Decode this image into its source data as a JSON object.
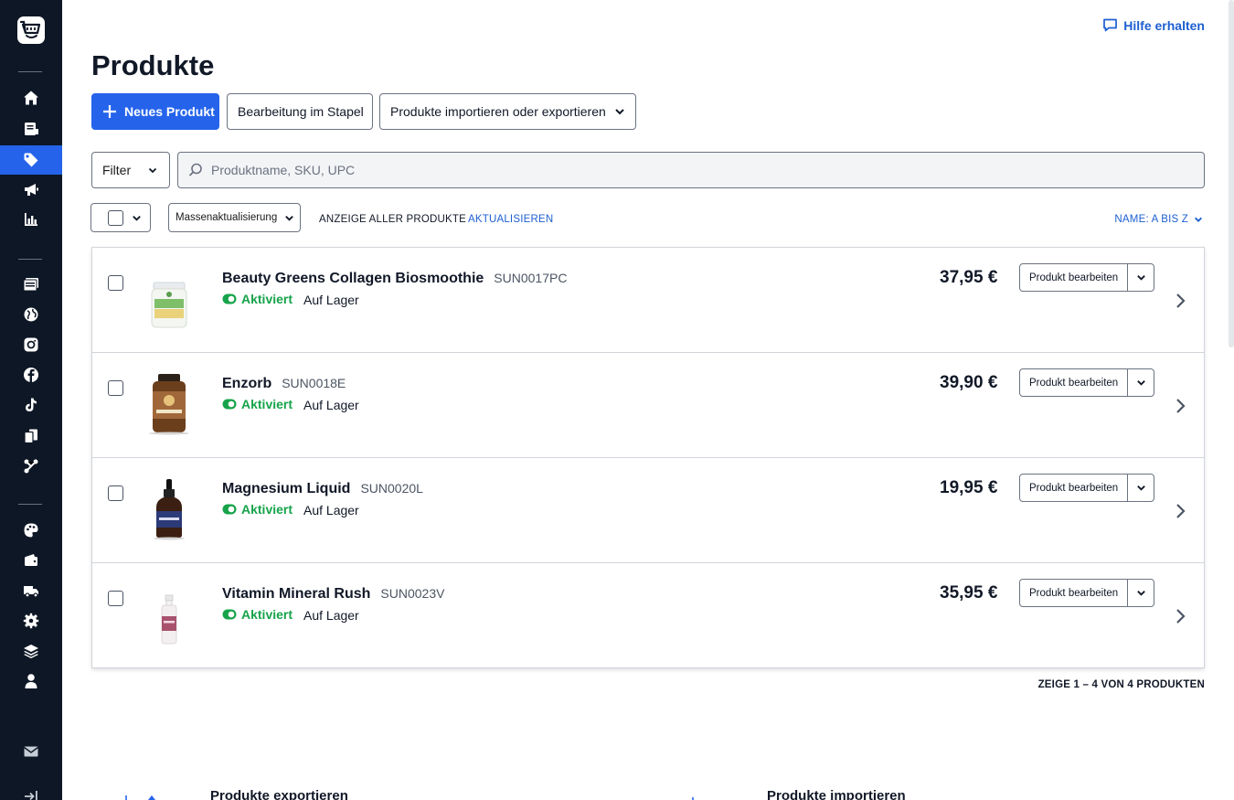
{
  "app": {
    "help_label": "Hilfe erhalten",
    "page_title": "Produkte"
  },
  "sidebar": {
    "items": [
      {
        "icon": "home-icon"
      },
      {
        "icon": "orders-icon"
      },
      {
        "icon": "tag-icon",
        "active": true
      },
      {
        "icon": "megaphone-icon"
      },
      {
        "icon": "bar-chart-icon"
      },
      {
        "icon": "store-icon"
      },
      {
        "icon": "globe-icon"
      },
      {
        "icon": "instagram-icon"
      },
      {
        "icon": "facebook-icon"
      },
      {
        "icon": "tiktok-icon"
      },
      {
        "icon": "channels-icon"
      },
      {
        "icon": "integrations-icon"
      },
      {
        "icon": "palette-icon"
      },
      {
        "icon": "wallet-icon"
      },
      {
        "icon": "truck-icon"
      },
      {
        "icon": "settings-icon"
      },
      {
        "icon": "layers-icon"
      },
      {
        "icon": "user-icon"
      },
      {
        "icon": "mail-icon"
      },
      {
        "icon": "collapse-icon"
      }
    ]
  },
  "toolbar": {
    "new_product": "Neues Produkt",
    "batch_edit": "Bearbeitung im Stapel",
    "import_export": "Produkte importieren oder exportieren"
  },
  "filters": {
    "filter_label": "Filter",
    "search_placeholder": "Produktname, SKU, UPC",
    "search_value": ""
  },
  "bulk": {
    "mass_update": "Massenaktualisierung",
    "showing": "ANZEIGE ALLER PRODUKTE",
    "refresh": "AKTUALISIEREN",
    "sort": "NAME: A BIS Z"
  },
  "products": [
    {
      "name": "Beauty Greens Collagen Biosmoothie",
      "sku": "SUN0017PC",
      "status": "Aktiviert",
      "stock": "Auf Lager",
      "price": "37,95 €",
      "edit": "Produkt bearbeiten",
      "thumb": "jar-white"
    },
    {
      "name": "Enzorb",
      "sku": "SUN0018E",
      "status": "Aktiviert",
      "stock": "Auf Lager",
      "price": "39,90 €",
      "edit": "Produkt bearbeiten",
      "thumb": "jar-brown"
    },
    {
      "name": "Magnesium Liquid",
      "sku": "SUN0020L",
      "status": "Aktiviert",
      "stock": "Auf Lager",
      "price": "19,95 €",
      "edit": "Produkt bearbeiten",
      "thumb": "dropper-bottle"
    },
    {
      "name": "Vitamin Mineral Rush",
      "sku": "SUN0023V",
      "status": "Aktiviert",
      "stock": "Auf Lager",
      "price": "35,95 €",
      "edit": "Produkt bearbeiten",
      "thumb": "spray-bottle"
    }
  ],
  "pagination": "ZEIGE 1 – 4 VON 4 PRODUKTEN",
  "bottom": {
    "export_title": "Produkte exportieren",
    "import_title": "Produkte importieren"
  },
  "colors": {
    "sidebar_bg": "#0e1726",
    "accent": "#2563eb",
    "link": "#1d5fd1",
    "status_green": "#16a34a"
  }
}
